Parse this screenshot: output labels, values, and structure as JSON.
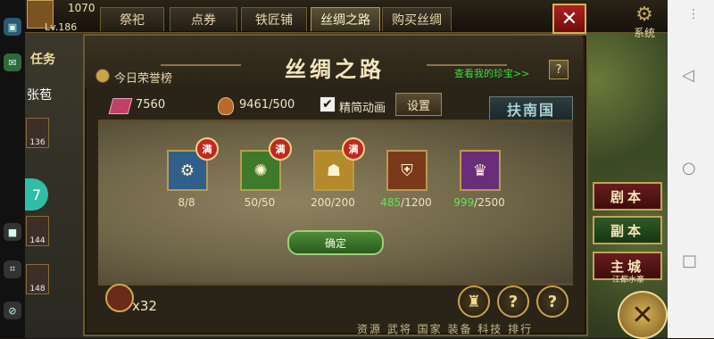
{
  "hud": {
    "gold": "1070",
    "level": "Lv.186",
    "side_levels": [
      "136",
      "144",
      "148"
    ],
    "sidebar_name": "张苞",
    "task_label": "任务"
  },
  "tabs": [
    {
      "label": "祭祀",
      "active": false
    },
    {
      "label": "点券",
      "active": false
    },
    {
      "label": "铁匠铺",
      "active": false
    },
    {
      "label": "丝绸之路",
      "active": true
    },
    {
      "label": "购买丝绸",
      "active": false
    }
  ],
  "system": {
    "label": "系统"
  },
  "panel": {
    "title": "丝绸之路",
    "honor_label": "今日荣誉榜",
    "treasure_link": "查看我的珍宝>>",
    "help": "?",
    "silk_value": "7560",
    "bag_value": "9461/500",
    "simple_anim_label": "精简动画",
    "simple_anim_checked": "✔",
    "settings_label": "设置",
    "country": "扶南国",
    "full_badge": "满",
    "items": [
      {
        "count_done": "8",
        "count_total": "/8",
        "full": true,
        "color": "#2f5f8a",
        "icon": "cannon-icon",
        "glyph": "⚙"
      },
      {
        "count_done": "50",
        "count_total": "/50",
        "full": true,
        "color": "#3f7a2a",
        "icon": "shield-green-icon",
        "glyph": "✺"
      },
      {
        "count_done": "200",
        "count_total": "/200",
        "full": true,
        "color": "#b48a2a",
        "icon": "helmet-icon",
        "glyph": "☗"
      },
      {
        "count_done": "485",
        "count_total": "/1200",
        "full": false,
        "color": "#7a3a1a",
        "icon": "bronze-shield-icon",
        "glyph": "⛨"
      },
      {
        "count_done": "999",
        "count_total": "/2500",
        "full": false,
        "color": "#6a2d7a",
        "icon": "purple-armor-icon",
        "glyph": "♛"
      }
    ],
    "confirm_label": "确定",
    "bottom_count": "x32",
    "bottom_menu": "资源 武将 国家 装备 科技 排行"
  },
  "side_buttons": {
    "script": "剧本",
    "dungeon": "副本",
    "capital": "主城"
  },
  "capital_name": "江都水寨",
  "colors": {
    "accent_gold": "#c9a24c",
    "green_text": "#3ddc3a",
    "close_red": "#b02020"
  }
}
